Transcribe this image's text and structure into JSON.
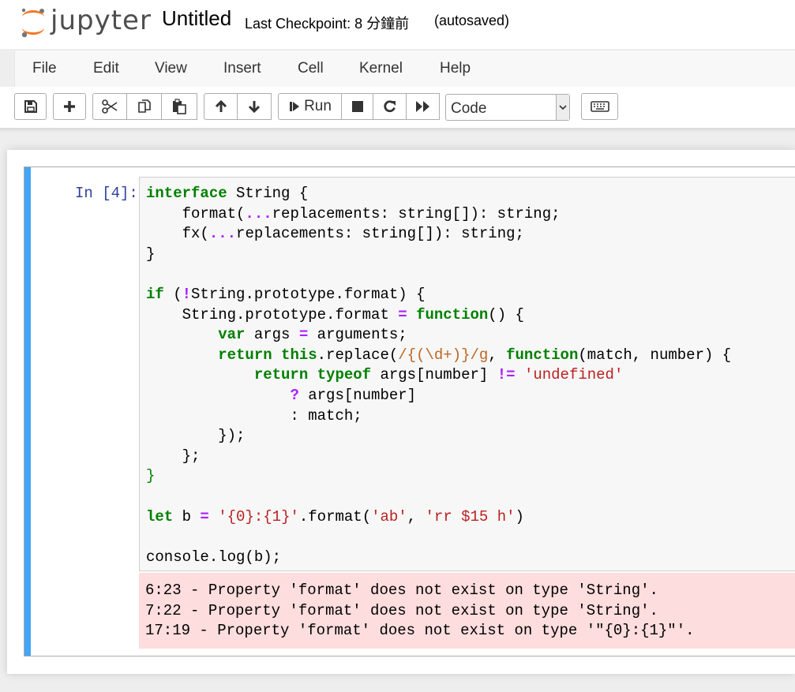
{
  "header": {
    "logo_text": "jupyter",
    "notebook_title": "Untitled",
    "checkpoint": "Last Checkpoint: 8 分鐘前",
    "autosave_status": "(autosaved)"
  },
  "menubar": {
    "items": [
      "File",
      "Edit",
      "View",
      "Insert",
      "Cell",
      "Kernel",
      "Help"
    ]
  },
  "toolbar": {
    "run_label": "Run",
    "cell_type": "Code",
    "icons": [
      "save-icon",
      "plus-icon",
      "cut-icon",
      "copy-icon",
      "paste-icon",
      "arrow-up-icon",
      "arrow-down-icon",
      "step-forward-icon",
      "stop-icon",
      "restart-icon",
      "fast-forward-icon",
      "keyboard-icon"
    ]
  },
  "cell": {
    "prompt": "In [4]:",
    "code_lines": [
      "interface String {",
      "    format(...replacements: string[]): string;",
      "    fx(...replacements: string[]): string;",
      "}",
      "",
      "if (!String.prototype.format) {",
      "    String.prototype.format = function() {",
      "        var args = arguments;",
      "        return this.replace(/{(\\d+)}/g, function(match, number) {",
      "            return typeof args[number] != 'undefined'",
      "                ? args[number]",
      "                : match;",
      "        });",
      "    };",
      "}",
      "",
      "let b = '{0}:{1}'.format('ab', 'rr $15 h')",
      "",
      "console.log(b);"
    ],
    "errors": [
      "6:23 - Property 'format' does not exist on type 'String'.",
      "7:22 - Property 'format' does not exist on type 'String'.",
      "17:19 - Property 'format' does not exist on type '\"{0}:{1}\"'."
    ]
  },
  "colors": {
    "cell_selected_bar": "#42a5f5",
    "error_background": "#fddddd",
    "keyword": "#008000",
    "string": "#ba2121",
    "prompt": "#303f9f"
  }
}
